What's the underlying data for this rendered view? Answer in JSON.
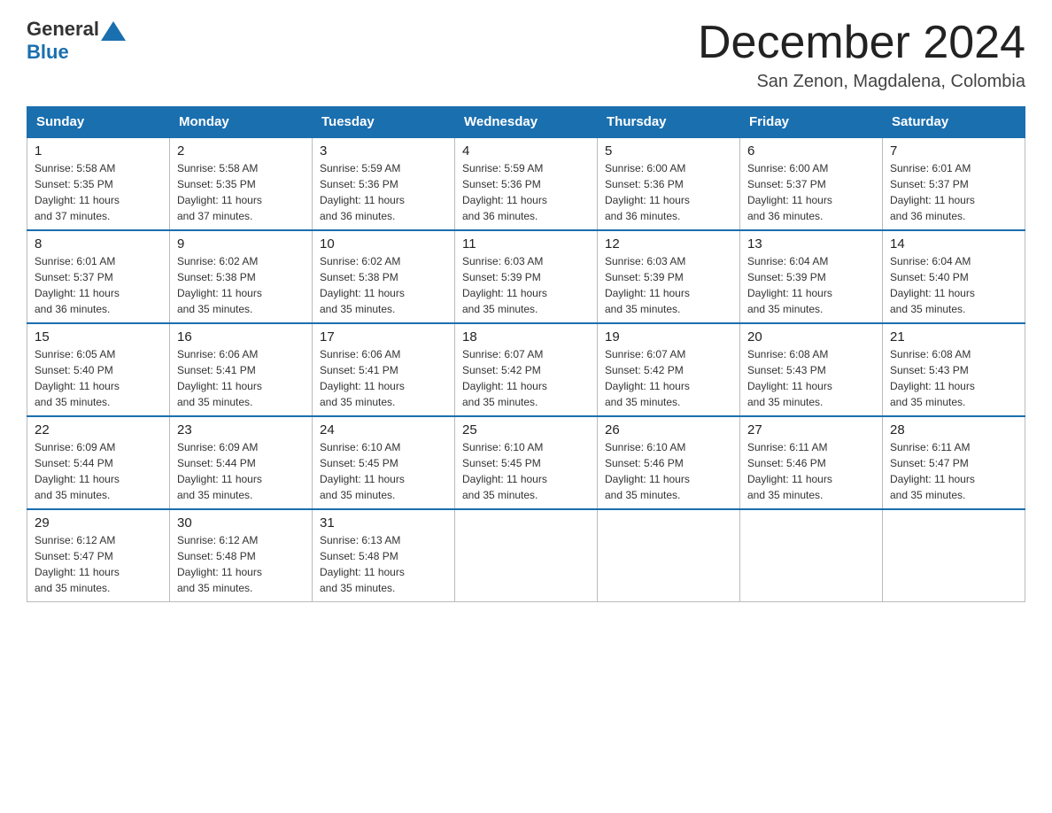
{
  "header": {
    "logo_general": "General",
    "logo_blue": "Blue",
    "month_title": "December 2024",
    "subtitle": "San Zenon, Magdalena, Colombia"
  },
  "weekdays": [
    "Sunday",
    "Monday",
    "Tuesday",
    "Wednesday",
    "Thursday",
    "Friday",
    "Saturday"
  ],
  "weeks": [
    [
      {
        "day": "1",
        "sunrise": "5:58 AM",
        "sunset": "5:35 PM",
        "daylight": "11 hours and 37 minutes."
      },
      {
        "day": "2",
        "sunrise": "5:58 AM",
        "sunset": "5:35 PM",
        "daylight": "11 hours and 37 minutes."
      },
      {
        "day": "3",
        "sunrise": "5:59 AM",
        "sunset": "5:36 PM",
        "daylight": "11 hours and 36 minutes."
      },
      {
        "day": "4",
        "sunrise": "5:59 AM",
        "sunset": "5:36 PM",
        "daylight": "11 hours and 36 minutes."
      },
      {
        "day": "5",
        "sunrise": "6:00 AM",
        "sunset": "5:36 PM",
        "daylight": "11 hours and 36 minutes."
      },
      {
        "day": "6",
        "sunrise": "6:00 AM",
        "sunset": "5:37 PM",
        "daylight": "11 hours and 36 minutes."
      },
      {
        "day": "7",
        "sunrise": "6:01 AM",
        "sunset": "5:37 PM",
        "daylight": "11 hours and 36 minutes."
      }
    ],
    [
      {
        "day": "8",
        "sunrise": "6:01 AM",
        "sunset": "5:37 PM",
        "daylight": "11 hours and 36 minutes."
      },
      {
        "day": "9",
        "sunrise": "6:02 AM",
        "sunset": "5:38 PM",
        "daylight": "11 hours and 35 minutes."
      },
      {
        "day": "10",
        "sunrise": "6:02 AM",
        "sunset": "5:38 PM",
        "daylight": "11 hours and 35 minutes."
      },
      {
        "day": "11",
        "sunrise": "6:03 AM",
        "sunset": "5:39 PM",
        "daylight": "11 hours and 35 minutes."
      },
      {
        "day": "12",
        "sunrise": "6:03 AM",
        "sunset": "5:39 PM",
        "daylight": "11 hours and 35 minutes."
      },
      {
        "day": "13",
        "sunrise": "6:04 AM",
        "sunset": "5:39 PM",
        "daylight": "11 hours and 35 minutes."
      },
      {
        "day": "14",
        "sunrise": "6:04 AM",
        "sunset": "5:40 PM",
        "daylight": "11 hours and 35 minutes."
      }
    ],
    [
      {
        "day": "15",
        "sunrise": "6:05 AM",
        "sunset": "5:40 PM",
        "daylight": "11 hours and 35 minutes."
      },
      {
        "day": "16",
        "sunrise": "6:06 AM",
        "sunset": "5:41 PM",
        "daylight": "11 hours and 35 minutes."
      },
      {
        "day": "17",
        "sunrise": "6:06 AM",
        "sunset": "5:41 PM",
        "daylight": "11 hours and 35 minutes."
      },
      {
        "day": "18",
        "sunrise": "6:07 AM",
        "sunset": "5:42 PM",
        "daylight": "11 hours and 35 minutes."
      },
      {
        "day": "19",
        "sunrise": "6:07 AM",
        "sunset": "5:42 PM",
        "daylight": "11 hours and 35 minutes."
      },
      {
        "day": "20",
        "sunrise": "6:08 AM",
        "sunset": "5:43 PM",
        "daylight": "11 hours and 35 minutes."
      },
      {
        "day": "21",
        "sunrise": "6:08 AM",
        "sunset": "5:43 PM",
        "daylight": "11 hours and 35 minutes."
      }
    ],
    [
      {
        "day": "22",
        "sunrise": "6:09 AM",
        "sunset": "5:44 PM",
        "daylight": "11 hours and 35 minutes."
      },
      {
        "day": "23",
        "sunrise": "6:09 AM",
        "sunset": "5:44 PM",
        "daylight": "11 hours and 35 minutes."
      },
      {
        "day": "24",
        "sunrise": "6:10 AM",
        "sunset": "5:45 PM",
        "daylight": "11 hours and 35 minutes."
      },
      {
        "day": "25",
        "sunrise": "6:10 AM",
        "sunset": "5:45 PM",
        "daylight": "11 hours and 35 minutes."
      },
      {
        "day": "26",
        "sunrise": "6:10 AM",
        "sunset": "5:46 PM",
        "daylight": "11 hours and 35 minutes."
      },
      {
        "day": "27",
        "sunrise": "6:11 AM",
        "sunset": "5:46 PM",
        "daylight": "11 hours and 35 minutes."
      },
      {
        "day": "28",
        "sunrise": "6:11 AM",
        "sunset": "5:47 PM",
        "daylight": "11 hours and 35 minutes."
      }
    ],
    [
      {
        "day": "29",
        "sunrise": "6:12 AM",
        "sunset": "5:47 PM",
        "daylight": "11 hours and 35 minutes."
      },
      {
        "day": "30",
        "sunrise": "6:12 AM",
        "sunset": "5:48 PM",
        "daylight": "11 hours and 35 minutes."
      },
      {
        "day": "31",
        "sunrise": "6:13 AM",
        "sunset": "5:48 PM",
        "daylight": "11 hours and 35 minutes."
      },
      null,
      null,
      null,
      null
    ]
  ],
  "labels": {
    "sunrise_prefix": "Sunrise: ",
    "sunset_prefix": "Sunset: ",
    "daylight_prefix": "Daylight: "
  }
}
